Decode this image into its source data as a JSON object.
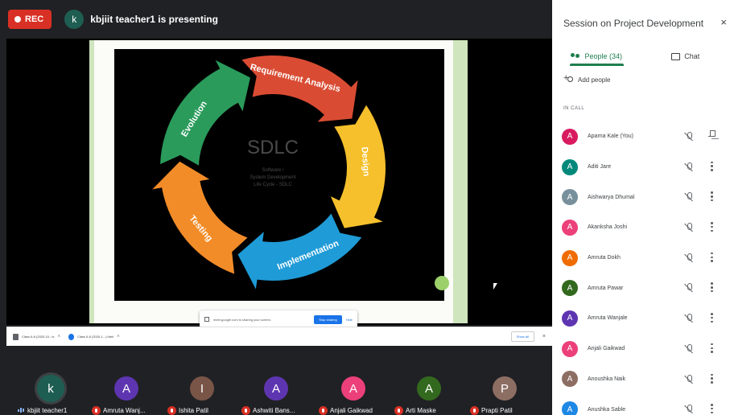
{
  "top_bar": {
    "rec_label": "REC",
    "presenter_initial": "k",
    "presenting_text": "kbjiit teacher1 is presenting"
  },
  "slide": {
    "center_title": "SDLC",
    "center_subtitle_lines": [
      "Software /",
      "System Development",
      "Life Cycle - SDLC"
    ],
    "phases": [
      "Requirement Analysis",
      "Design",
      "Implementation",
      "Testing",
      "Evolution"
    ],
    "phase_colors": [
      "#d94c33",
      "#f5c02b",
      "#1f9bd7",
      "#f28c28",
      "#2a9b5b"
    ]
  },
  "share_bar": {
    "text": "meet.google.com is sharing your screen.",
    "stop_label": "Stop sharing",
    "hide_label": "Hide"
  },
  "downloads": {
    "items": [
      "Class 6-8 (2020-10...tx",
      "Class 6-8 (2020-1...).html"
    ],
    "show_all_label": "Show all",
    "close_symbol": "×",
    "chevron_symbol": "˄"
  },
  "tiles": [
    {
      "initial": "k",
      "name": "kbjiit teacher1",
      "color": "#1e5e52",
      "speaking": true
    },
    {
      "initial": "A",
      "name": "Amruta Wanj...",
      "color": "#5e35b1",
      "speaking": false
    },
    {
      "initial": "I",
      "name": "Ishita Patil",
      "color": "#795548",
      "speaking": false
    },
    {
      "initial": "A",
      "name": "Ashwiti Bans...",
      "color": "#5e35b1",
      "speaking": false
    },
    {
      "initial": "A",
      "name": "Anjali Gaikwad",
      "color": "#ec407a",
      "speaking": false
    },
    {
      "initial": "A",
      "name": "Arti Maske",
      "color": "#33691e",
      "speaking": false
    },
    {
      "initial": "P",
      "name": "Prapti Patil",
      "color": "#8d6e63",
      "speaking": false
    }
  ],
  "panel": {
    "title": "Session on Project Development",
    "close_symbol": "×",
    "tabs": {
      "people": "People (34)",
      "chat": "Chat"
    },
    "add_people": "Add people",
    "in_call": "IN CALL",
    "people": [
      {
        "initial": "A",
        "name": "Aparna Kale (You)",
        "color": "#d81b60",
        "is_you": true
      },
      {
        "initial": "A",
        "name": "Aditi Jare",
        "color": "#00897b",
        "is_you": false
      },
      {
        "initial": "A",
        "name": "Aishwarya Dhumal",
        "color": "#78909c",
        "is_you": false
      },
      {
        "initial": "A",
        "name": "Akanksha Joshi",
        "color": "#ec407a",
        "is_you": false
      },
      {
        "initial": "A",
        "name": "Amruta Dokh",
        "color": "#ef6c00",
        "is_you": false
      },
      {
        "initial": "A",
        "name": "Amruta Pawar",
        "color": "#33691e",
        "is_you": false
      },
      {
        "initial": "A",
        "name": "Amruta Wanjale",
        "color": "#5e35b1",
        "is_you": false
      },
      {
        "initial": "A",
        "name": "Anjali Gaikwad",
        "color": "#ec407a",
        "is_you": false
      },
      {
        "initial": "A",
        "name": "Anoushka Naik",
        "color": "#8d6e63",
        "is_you": false
      },
      {
        "initial": "A",
        "name": "Anushka Sable",
        "color": "#1e88e5",
        "is_you": false
      }
    ]
  }
}
